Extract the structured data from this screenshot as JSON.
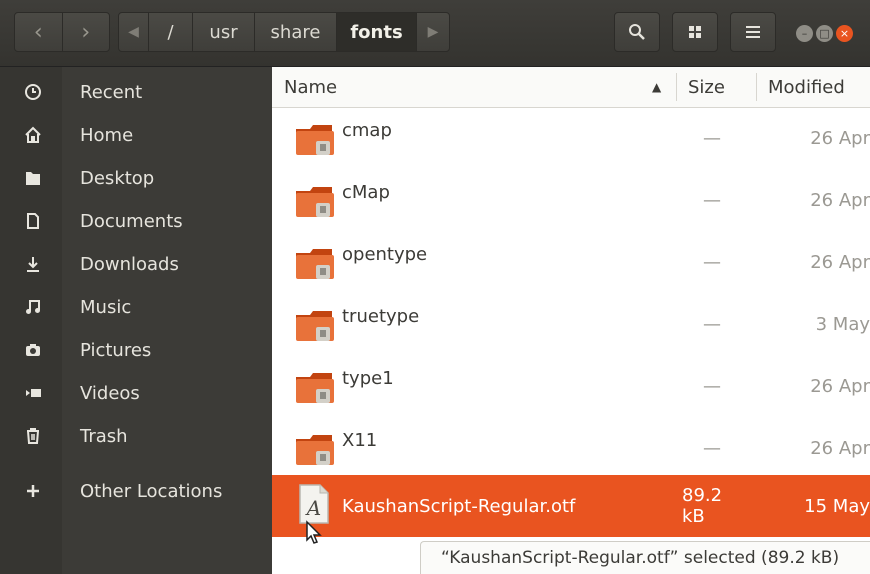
{
  "header": {
    "path": [
      "/",
      "usr",
      "share",
      "fonts"
    ],
    "icons": [
      "back-icon",
      "forward-icon",
      "search-icon",
      "grid-view-icon",
      "menu-icon"
    ],
    "window_buttons": [
      "minimize",
      "maximize",
      "close"
    ]
  },
  "sidebar": {
    "items": [
      {
        "label": "Recent",
        "icon": "clock-icon"
      },
      {
        "label": "Home",
        "icon": "home-icon"
      },
      {
        "label": "Desktop",
        "icon": "desktop-folder-icon"
      },
      {
        "label": "Documents",
        "icon": "document-icon"
      },
      {
        "label": "Downloads",
        "icon": "download-icon"
      },
      {
        "label": "Music",
        "icon": "music-icon"
      },
      {
        "label": "Pictures",
        "icon": "camera-icon"
      },
      {
        "label": "Videos",
        "icon": "video-icon"
      },
      {
        "label": "Trash",
        "icon": "trash-icon"
      },
      {
        "label": "Other Locations",
        "icon": "plus-icon"
      }
    ]
  },
  "columns": {
    "name": "Name",
    "size": "Size",
    "modified": "Modified"
  },
  "files": [
    {
      "name": "cmap",
      "size": "—",
      "modified": "26 Apr",
      "type": "folder"
    },
    {
      "name": "cMap",
      "size": "—",
      "modified": "26 Apr",
      "type": "folder"
    },
    {
      "name": "opentype",
      "size": "—",
      "modified": "26 Apr",
      "type": "folder"
    },
    {
      "name": "truetype",
      "size": "—",
      "modified": "3 May",
      "type": "folder"
    },
    {
      "name": "type1",
      "size": "—",
      "modified": "26 Apr",
      "type": "folder"
    },
    {
      "name": "X11",
      "size": "—",
      "modified": "26 Apr",
      "type": "folder"
    },
    {
      "name": "KaushanScript-Regular.otf",
      "size": "89.2 kB",
      "modified": "15 May",
      "type": "font-file",
      "selected": true
    }
  ],
  "status_text": "“KaushanScript-Regular.otf” selected (89.2 kB)",
  "colors": {
    "accent": "#e95420",
    "sidebar": "#3c3b37",
    "header": "#3f3e3a"
  }
}
